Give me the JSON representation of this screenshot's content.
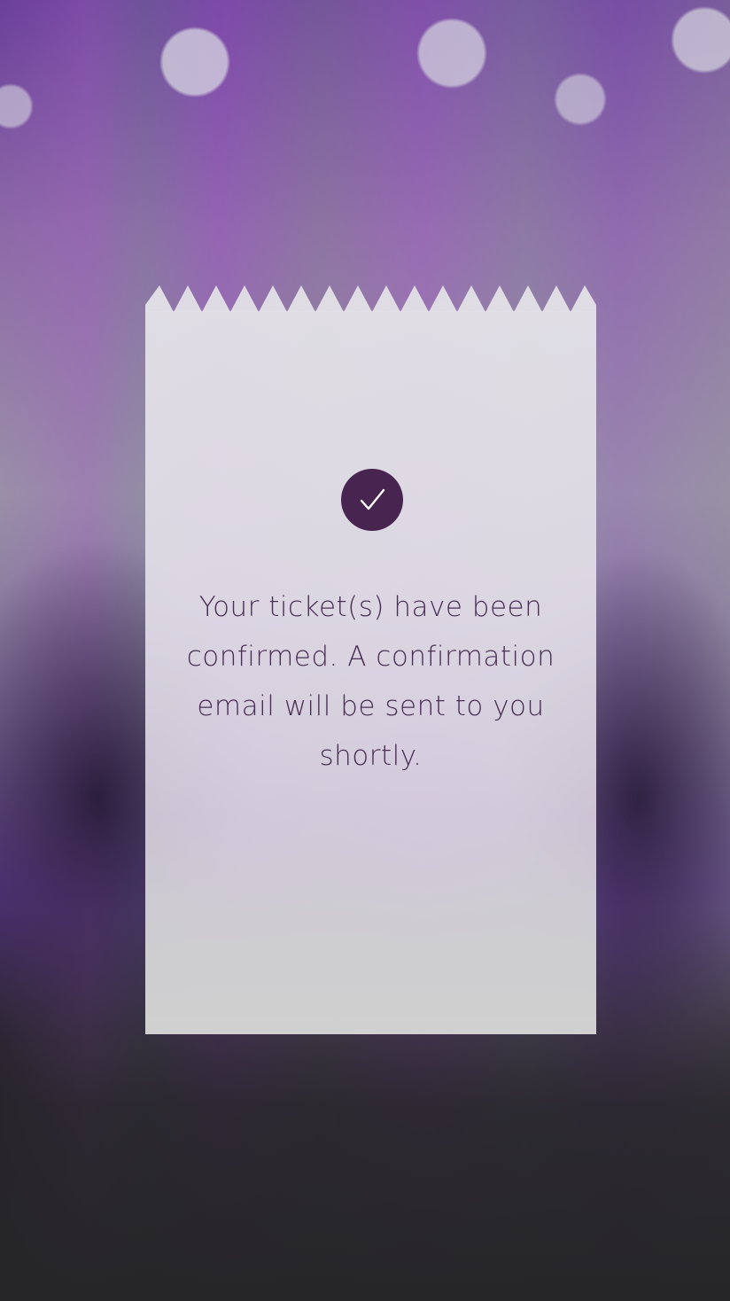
{
  "screen": {
    "background": "concert-crowd-photo"
  },
  "colors": {
    "accent": "#482451",
    "ticket_paper": "#e0dee4",
    "message_text": "#4a2e56"
  },
  "confirmation": {
    "icon": "checkmark-icon",
    "message": "Your ticket(s) have been confirmed. A confirmation email will be sent to you shortly."
  }
}
